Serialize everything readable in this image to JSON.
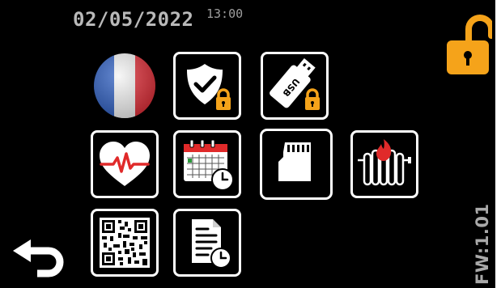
{
  "status": {
    "date": "02/05/2022",
    "time": "13:00",
    "firmware": "FW:1.01"
  },
  "colors": {
    "background": "#000000",
    "tile_border": "#ffffff",
    "lock_orange": "#f5a31a",
    "accent_red": "#e02a2a",
    "flag_blue": "#2f5fc0",
    "flag_red": "#e0303a"
  },
  "menu": {
    "items": [
      {
        "icon": "french-flag-icon"
      },
      {
        "icon": "shield-lock-icon"
      },
      {
        "icon": "usb-lock-icon",
        "label": "USB"
      },
      {
        "icon": "heart-rate-icon"
      },
      {
        "icon": "calendar-clock-icon"
      },
      {
        "icon": "sd-card-icon",
        "selected": true
      },
      {
        "icon": "radiator-flame-icon"
      },
      {
        "icon": "qr-code-icon"
      },
      {
        "icon": "document-clock-icon"
      }
    ]
  }
}
